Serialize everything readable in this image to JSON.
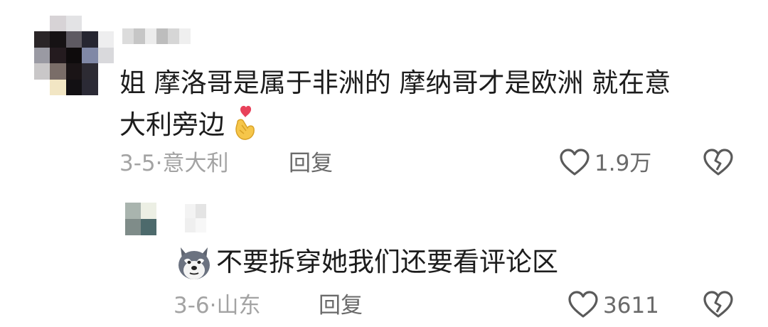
{
  "comment": {
    "text_line1": "姐 摩洛哥是属于非洲的 摩纳哥才是欧洲 就在意",
    "text_line2": "大利旁边",
    "emoji": "finger-heart-emoji",
    "date": "3-5",
    "separator": "·",
    "location": "意大利",
    "reply_label": "回复",
    "like_count": "1.9万",
    "like_icon": "heart-outline-icon",
    "dislike_icon": "broken-heart-icon"
  },
  "reply": {
    "sticker": "husky-dog-emoji",
    "text": "不要拆穿她我们还要看评论区",
    "date": "3-6",
    "separator": "·",
    "location": "山东",
    "reply_label": "回复",
    "like_count": "3611",
    "like_icon": "heart-outline-icon",
    "dislike_icon": "broken-heart-icon"
  },
  "colors": {
    "text": "#1c1c1c",
    "meta": "#a3a3a3",
    "action": "#6a6a6a",
    "accent_heart": "#e8415a"
  }
}
